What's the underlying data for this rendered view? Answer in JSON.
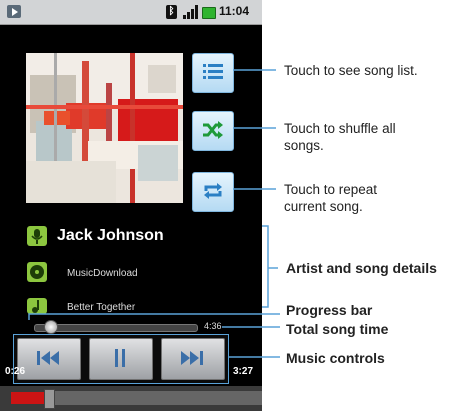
{
  "status_bar": {
    "time": "11:04"
  },
  "player": {
    "artist": "Jack Johnson",
    "album": "MusicDownload",
    "song": "Better Together",
    "total_time": "4:36",
    "elapsed_time": "0:26",
    "remaining_time": "3:27",
    "progress_fraction": 0.094
  },
  "icons": {
    "song_list": "list-icon",
    "shuffle": "shuffle-icon",
    "repeat": "repeat-icon",
    "artist": "microphone-icon",
    "album": "album-disc-icon",
    "song": "music-note-icon",
    "previous": "previous-track-icon",
    "pause": "pause-icon",
    "next": "next-track-icon"
  },
  "colors": {
    "accent_blue": "#5aa2d8",
    "artist_icon": "#8cc63f",
    "progress_red": "#cc1414"
  },
  "callouts": {
    "song_list": [
      "Touch to see song list."
    ],
    "shuffle": [
      "Touch to shuffle all",
      "songs."
    ],
    "repeat": [
      "Touch to repeat",
      "current song."
    ],
    "details": "Artist and song details",
    "progress": "Progress bar",
    "total_time": "Total song time",
    "controls": "Music controls"
  }
}
